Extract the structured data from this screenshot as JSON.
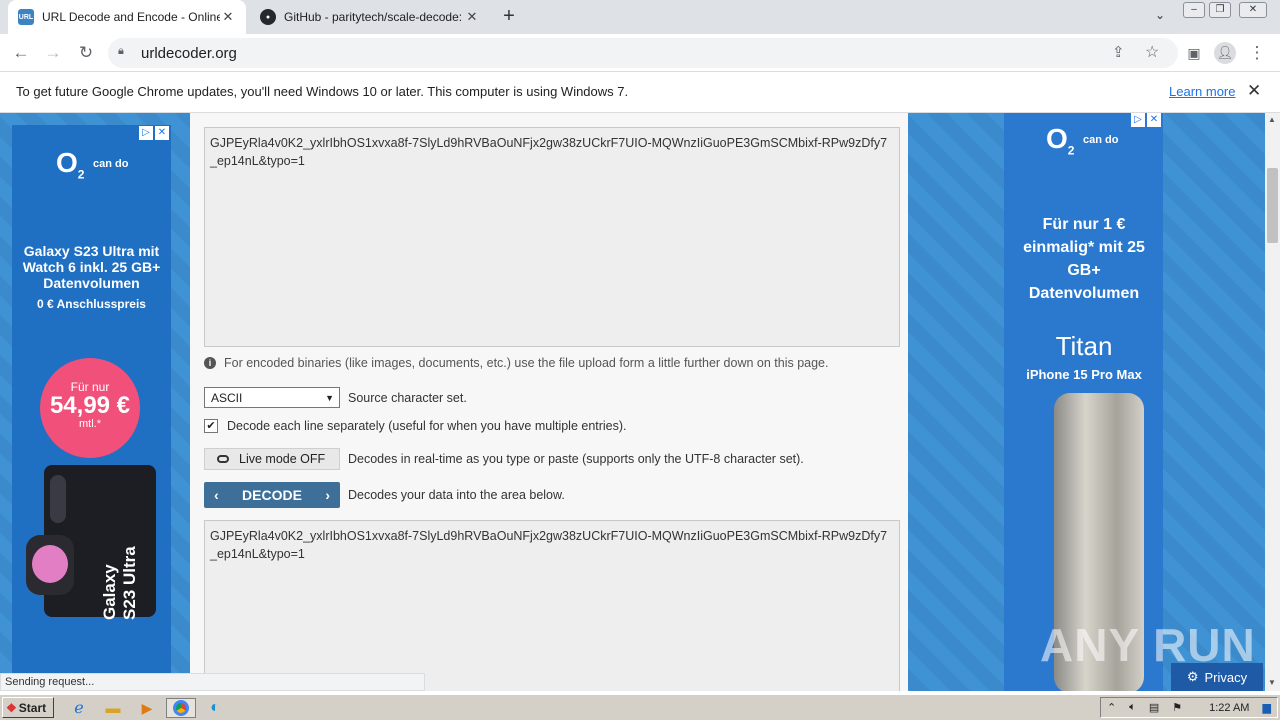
{
  "browser": {
    "tabs": [
      {
        "title": "URL Decode and Encode - Online",
        "favicon": "URL"
      },
      {
        "title": "GitHub - paritytech/scale-decode: De"
      }
    ],
    "url": "urldecoder.org",
    "infobar": {
      "text": "To get future Google Chrome updates, you'll need Windows 10 or later. This computer is using Windows 7.",
      "link": "Learn more"
    },
    "status": "Sending request..."
  },
  "page": {
    "input_text": "GJPEyRla4v0K2_yxlrIbhOS1xvxa8f-7SlyLd9hRVBaOuNFjx2gw38zUCkrF7UIO-MQWnzIiGuoPE3GmSCMbixf-RPw9zDfy7_ep14nL&typo=1",
    "binaries_note": "For encoded binaries (like images, documents, etc.) use the file upload form a little further down on this page.",
    "charset_value": "ASCII",
    "charset_label": "Source character set.",
    "each_line_label": "Decode each line separately (useful for when you have multiple entries).",
    "each_line_checked": true,
    "live_mode_label": "Live mode OFF",
    "live_mode_desc": "Decodes in real-time as you type or paste (supports only the UTF-8 character set).",
    "decode_label": "DECODE",
    "decode_desc": "Decodes your data into the area below.",
    "output_text": "GJPEyRla4v0K2_yxlrIbhOS1xvxa8f-7SlyLd9hRVBaOuNFjx2gw38zUCkrF7UIO-MQWnzIiGuoPE3GmSCMbixf-RPw9zDfy7_ep14nL&typo=1"
  },
  "ad_left": {
    "brand": "O",
    "brand_sub": "2",
    "tagline": "can do",
    "headline": "Galaxy S23 Ultra mit Watch 6 inkl. 25 GB+ Datenvolumen",
    "subline": "0 € Anschlusspreis",
    "price_prefix": "Für nur",
    "price": "54,99 €",
    "price_suffix": "mtl.*",
    "product": "Galaxy S23 Ultra"
  },
  "ad_right": {
    "brand": "O",
    "brand_sub": "2",
    "tagline": "can do",
    "headline": "Für nur 1 € einmalig* mit 25 GB+ Datenvolumen",
    "plan": "Titan",
    "product": "iPhone 15 Pro Max"
  },
  "privacy_label": "Privacy",
  "watermark": "ANY RUN",
  "taskbar": {
    "start": "Start",
    "clock": "1:22 AM"
  }
}
